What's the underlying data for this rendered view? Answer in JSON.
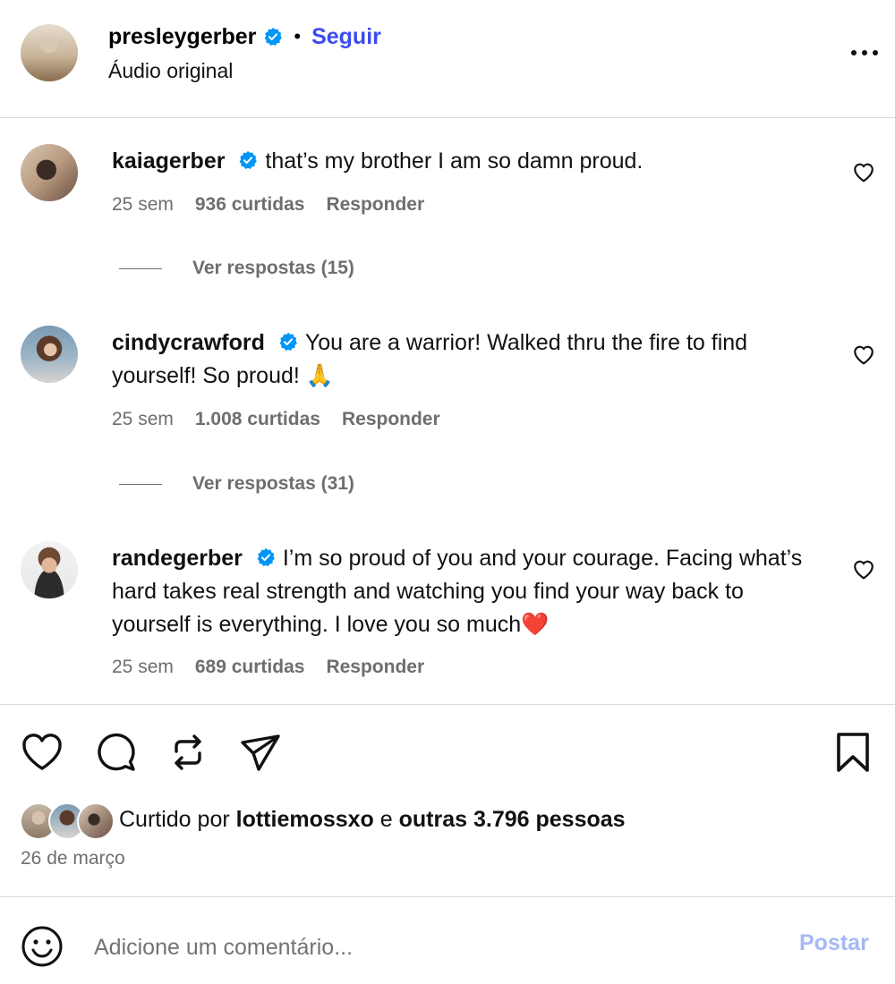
{
  "header": {
    "username": "presleygerber",
    "separator": "•",
    "follow_label": "Seguir",
    "subtitle": "Áudio original",
    "more_icon": "more-horizontal-icon"
  },
  "comments": [
    {
      "username": "kaiagerber",
      "text": "that’s my brother I am so damn proud.",
      "time": "25 sem",
      "likes": "936 curtidas",
      "reply_label": "Responder",
      "view_replies": "Ver respostas (15)"
    },
    {
      "username": "cindycrawford",
      "text": "You are a warrior! Walked thru the fire to find yourself! So proud! 🙏",
      "time": "25 sem",
      "likes": "1.008 curtidas",
      "reply_label": "Responder",
      "view_replies": "Ver respostas (31)"
    },
    {
      "username": "randegerber",
      "text": "I’m so proud of you and your courage. Facing what’s hard takes real strength and watching you find your way back to yourself is everything. I love you so much❤️",
      "time": "25 sem",
      "likes": "689 curtidas",
      "reply_label": "Responder"
    }
  ],
  "likes_summary": {
    "prefix": "Curtido por",
    "user": "lottiemossxo",
    "connector": "e",
    "others": "outras 3.796 pessoas"
  },
  "date": "26 de março",
  "comment_box": {
    "placeholder": "Adicione um comentário...",
    "post_label": "Postar"
  },
  "colors": {
    "verified": "#0095f6",
    "link": "#3b4bef",
    "post_disabled": "#a5b8f5",
    "muted": "#6e6e6e"
  }
}
